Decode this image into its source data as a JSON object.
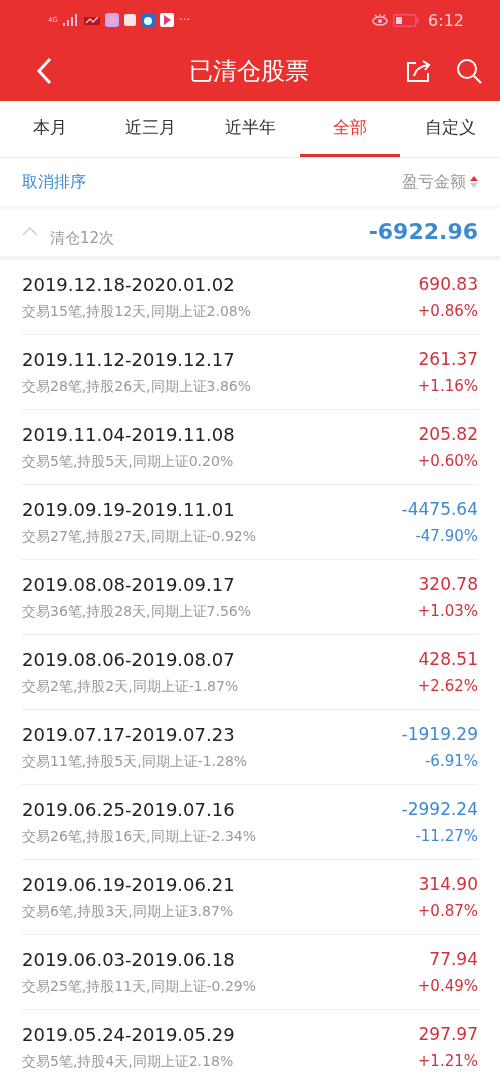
{
  "status_bar": {
    "network": "4G",
    "more": "···",
    "time": "6:12"
  },
  "header": {
    "title": "已清仓股票"
  },
  "tabs": [
    {
      "label": "本月",
      "selected": false
    },
    {
      "label": "近三月",
      "selected": false
    },
    {
      "label": "近半年",
      "selected": false
    },
    {
      "label": "全部",
      "selected": true
    },
    {
      "label": "自定义",
      "selected": false
    }
  ],
  "sort_bar": {
    "cancel": "取消排序",
    "column": "盈亏金额"
  },
  "summary": {
    "count": "清仓12次",
    "amount": "-6922.96",
    "expanded": true
  },
  "rows": [
    {
      "period": "2019.12.18-2020.01.02",
      "detail": "交易15笔,持股12天,同期上证2.08%",
      "amount": "690.83",
      "rate": "+0.86%",
      "kind": "gain"
    },
    {
      "period": "2019.11.12-2019.12.17",
      "detail": "交易28笔,持股26天,同期上证3.86%",
      "amount": "261.37",
      "rate": "+1.16%",
      "kind": "gain"
    },
    {
      "period": "2019.11.04-2019.11.08",
      "detail": "交易5笔,持股5天,同期上证0.20%",
      "amount": "205.82",
      "rate": "+0.60%",
      "kind": "gain"
    },
    {
      "period": "2019.09.19-2019.11.01",
      "detail": "交易27笔,持股27天,同期上证-0.92%",
      "amount": "-4475.64",
      "rate": "-47.90%",
      "kind": "loss"
    },
    {
      "period": "2019.08.08-2019.09.17",
      "detail": "交易36笔,持股28天,同期上证7.56%",
      "amount": "320.78",
      "rate": "+1.03%",
      "kind": "gain"
    },
    {
      "period": "2019.08.06-2019.08.07",
      "detail": "交易2笔,持股2天,同期上证-1.87%",
      "amount": "428.51",
      "rate": "+2.62%",
      "kind": "gain"
    },
    {
      "period": "2019.07.17-2019.07.23",
      "detail": "交易11笔,持股5天,同期上证-1.28%",
      "amount": "-1919.29",
      "rate": "-6.91%",
      "kind": "loss"
    },
    {
      "period": "2019.06.25-2019.07.16",
      "detail": "交易26笔,持股16天,同期上证-2.34%",
      "amount": "-2992.24",
      "rate": "-11.27%",
      "kind": "loss"
    },
    {
      "period": "2019.06.19-2019.06.21",
      "detail": "交易6笔,持股3天,同期上证3.87%",
      "amount": "314.90",
      "rate": "+0.87%",
      "kind": "gain"
    },
    {
      "period": "2019.06.03-2019.06.18",
      "detail": "交易25笔,持股11天,同期上证-0.29%",
      "amount": "77.94",
      "rate": "+0.49%",
      "kind": "gain"
    },
    {
      "period": "2019.05.24-2019.05.29",
      "detail": "交易5笔,持股4天,同期上证2.18%",
      "amount": "297.97",
      "rate": "+1.21%",
      "kind": "gain"
    }
  ]
}
